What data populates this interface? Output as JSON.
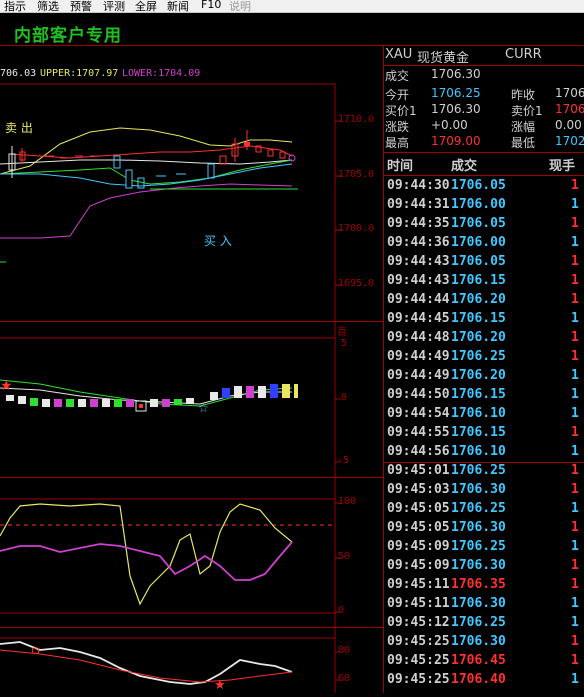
{
  "menu": {
    "items": [
      {
        "label": "指示",
        "disabled": false
      },
      {
        "label": "筛选",
        "disabled": false
      },
      {
        "label": "预警",
        "disabled": false
      },
      {
        "label": "评测",
        "disabled": false
      },
      {
        "label": "全屏",
        "disabled": false
      },
      {
        "label": "新闻",
        "disabled": false
      },
      {
        "label": "F10",
        "disabled": false
      },
      {
        "label": "说明",
        "disabled": true
      }
    ]
  },
  "banner": {
    "text": "内部客户专用"
  },
  "chart": {
    "boll": {
      "mid": "706.03",
      "upper": "UPPER:1707.97",
      "lower": "LOWER:1704.09"
    },
    "price_axis": [
      "1710.0",
      "1705.0",
      "1700.0",
      "1695.0"
    ],
    "sell_label": "卖 出",
    "buy_label": "买 入",
    "macd_top_label": "百",
    "macd_axis": [
      "5",
      "0",
      "-5"
    ],
    "kdj_axis": [
      "100",
      "50",
      "0"
    ],
    "rsi_axis": [
      "80",
      "60"
    ],
    "colors": {
      "up": "#ff3030",
      "down": "#40c8ff",
      "upper": "#e8e860",
      "mid": "#e8e8e8",
      "lower": "#d040d0",
      "green": "#30e030"
    }
  },
  "info": {
    "symbol": "XAU",
    "name": "现货黄金",
    "mode": "CURR",
    "latest_label": "成交",
    "latest_value": "1706.30",
    "rows": [
      {
        "l1": "今开",
        "v1": "1706.25",
        "c1": "#40c8ff",
        "l2": "昨收",
        "v2": "1706",
        "c2": "#d0d0d0"
      },
      {
        "l1": "买价1",
        "v1": "1706.30",
        "c1": "#d0d0d0",
        "l2": "卖价1",
        "v2": "1706",
        "c2": "#ff3030"
      },
      {
        "l1": "涨跌",
        "v1": "+0.00",
        "c1": "#d0d0d0",
        "l2": "涨幅",
        "v2": "0.00",
        "c2": "#d0d0d0"
      },
      {
        "l1": "最高",
        "v1": "1709.00",
        "c1": "#ff3030",
        "l2": "最低",
        "v2": "1702",
        "c2": "#40c8ff"
      }
    ],
    "ticks_header": {
      "time": "时间",
      "price": "成交",
      "vol": "现手"
    },
    "ticks": [
      {
        "time": "09:44:30",
        "price": "1706.05",
        "vol": "1",
        "pc": "#40c8ff",
        "vc": "#ff3030"
      },
      {
        "time": "09:44:31",
        "price": "1706.00",
        "vol": "1",
        "pc": "#40c8ff",
        "vc": "#40c8ff"
      },
      {
        "time": "09:44:35",
        "price": "1706.05",
        "vol": "1",
        "pc": "#40c8ff",
        "vc": "#ff3030"
      },
      {
        "time": "09:44:36",
        "price": "1706.00",
        "vol": "1",
        "pc": "#40c8ff",
        "vc": "#40c8ff"
      },
      {
        "time": "09:44:43",
        "price": "1706.05",
        "vol": "1",
        "pc": "#40c8ff",
        "vc": "#ff3030"
      },
      {
        "time": "09:44:43",
        "price": "1706.15",
        "vol": "1",
        "pc": "#40c8ff",
        "vc": "#ff3030"
      },
      {
        "time": "09:44:44",
        "price": "1706.20",
        "vol": "1",
        "pc": "#40c8ff",
        "vc": "#ff3030"
      },
      {
        "time": "09:44:45",
        "price": "1706.15",
        "vol": "1",
        "pc": "#40c8ff",
        "vc": "#40c8ff"
      },
      {
        "time": "09:44:48",
        "price": "1706.20",
        "vol": "1",
        "pc": "#40c8ff",
        "vc": "#ff3030"
      },
      {
        "time": "09:44:49",
        "price": "1706.25",
        "vol": "1",
        "pc": "#40c8ff",
        "vc": "#ff3030"
      },
      {
        "time": "09:44:49",
        "price": "1706.20",
        "vol": "1",
        "pc": "#40c8ff",
        "vc": "#40c8ff"
      },
      {
        "time": "09:44:50",
        "price": "1706.15",
        "vol": "1",
        "pc": "#40c8ff",
        "vc": "#40c8ff"
      },
      {
        "time": "09:44:54",
        "price": "1706.10",
        "vol": "1",
        "pc": "#40c8ff",
        "vc": "#40c8ff"
      },
      {
        "time": "09:44:55",
        "price": "1706.15",
        "vol": "1",
        "pc": "#40c8ff",
        "vc": "#ff3030"
      },
      {
        "time": "09:44:56",
        "price": "1706.10",
        "vol": "1",
        "pc": "#40c8ff",
        "vc": "#40c8ff"
      },
      {
        "time": "09:45:01",
        "price": "1706.25",
        "vol": "1",
        "pc": "#40c8ff",
        "vc": "#ff3030"
      },
      {
        "time": "09:45:03",
        "price": "1706.30",
        "vol": "1",
        "pc": "#40c8ff",
        "vc": "#ff3030"
      },
      {
        "time": "09:45:05",
        "price": "1706.25",
        "vol": "1",
        "pc": "#40c8ff",
        "vc": "#40c8ff"
      },
      {
        "time": "09:45:05",
        "price": "1706.30",
        "vol": "1",
        "pc": "#40c8ff",
        "vc": "#ff3030"
      },
      {
        "time": "09:45:09",
        "price": "1706.25",
        "vol": "1",
        "pc": "#40c8ff",
        "vc": "#40c8ff"
      },
      {
        "time": "09:45:09",
        "price": "1706.30",
        "vol": "1",
        "pc": "#40c8ff",
        "vc": "#ff3030"
      },
      {
        "time": "09:45:11",
        "price": "1706.35",
        "vol": "1",
        "pc": "#ff3030",
        "vc": "#ff3030"
      },
      {
        "time": "09:45:11",
        "price": "1706.30",
        "vol": "1",
        "pc": "#40c8ff",
        "vc": "#40c8ff"
      },
      {
        "time": "09:45:12",
        "price": "1706.25",
        "vol": "1",
        "pc": "#40c8ff",
        "vc": "#40c8ff"
      },
      {
        "time": "09:45:25",
        "price": "1706.30",
        "vol": "1",
        "pc": "#40c8ff",
        "vc": "#ff3030"
      },
      {
        "time": "09:45:25",
        "price": "1706.45",
        "vol": "1",
        "pc": "#ff3030",
        "vc": "#ff3030"
      },
      {
        "time": "09:45:25",
        "price": "1706.40",
        "vol": "1",
        "pc": "#ff3030",
        "vc": "#40c8ff"
      }
    ]
  }
}
